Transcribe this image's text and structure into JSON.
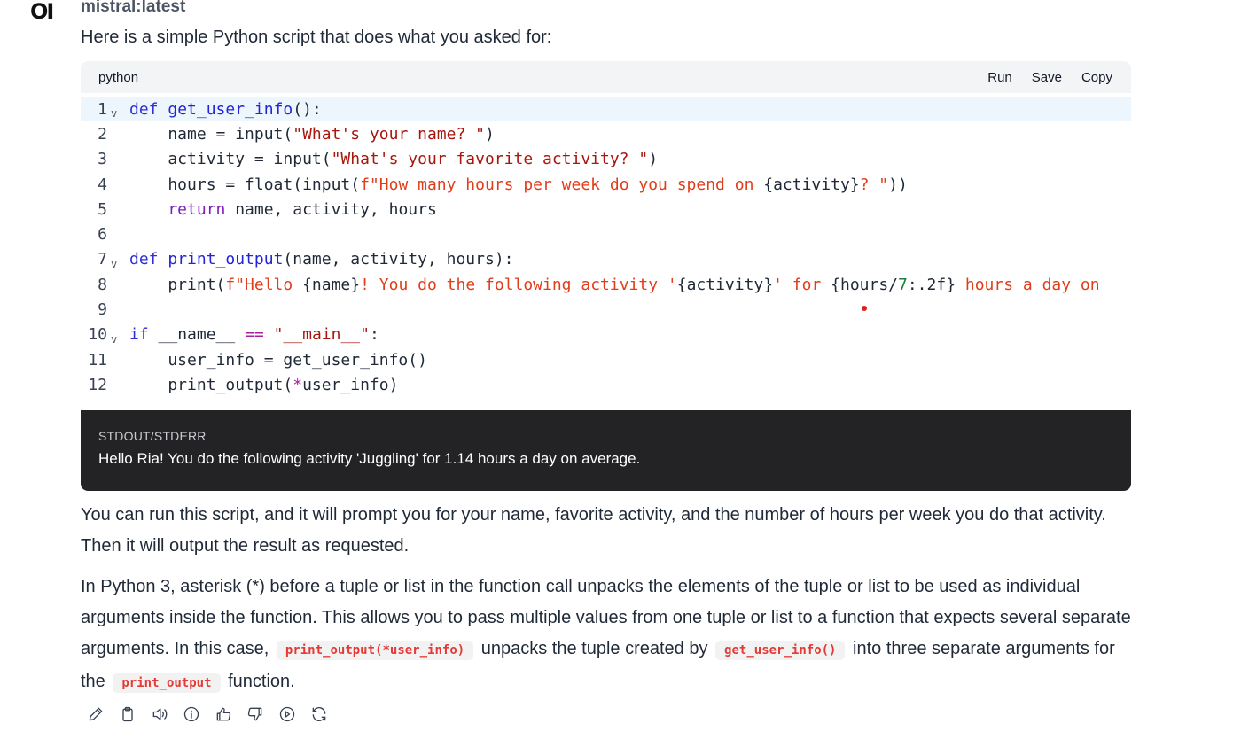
{
  "avatar": {
    "text": "OI"
  },
  "model": {
    "name": "mistral:latest"
  },
  "message": {
    "intro": "Here is a simple Python script that does what you asked for:"
  },
  "code_block": {
    "language": "python",
    "actions": {
      "run": "Run",
      "save": "Save",
      "copy": "Copy"
    },
    "lines": [
      {
        "num": "1",
        "fold": true
      },
      {
        "num": "2",
        "fold": false
      },
      {
        "num": "3",
        "fold": false
      },
      {
        "num": "4",
        "fold": false
      },
      {
        "num": "5",
        "fold": false
      },
      {
        "num": "6",
        "fold": false
      },
      {
        "num": "7",
        "fold": true
      },
      {
        "num": "8",
        "fold": false
      },
      {
        "num": "9",
        "fold": false
      },
      {
        "num": "10",
        "fold": true
      },
      {
        "num": "11",
        "fold": false
      },
      {
        "num": "12",
        "fold": false
      }
    ],
    "code": {
      "l1_def": "def",
      "l1_fn": "get_user_info",
      "l1_rest": "():",
      "l2_a": "    name = input(",
      "l2_str": "\"What's your name? \"",
      "l2_b": ")",
      "l3_a": "    activity = input(",
      "l3_str": "\"What's your favorite activity? \"",
      "l3_b": ")",
      "l4_a": "    hours = float(input(",
      "l4_f": "f\"How many hours per week do you spend on ",
      "l4_brace": "{activity}",
      "l4_f2": "? \"",
      "l4_b": "))",
      "l5_kw": "    return",
      "l5_rest": " name, activity, hours",
      "l7_def": "def",
      "l7_fn": "print_output",
      "l7_rest": "(name, activity, hours):",
      "l8_a": "    print(",
      "l8_f1": "f\"Hello ",
      "l8_b1": "{name}",
      "l8_f2": "! You do the following activity '",
      "l8_b2": "{activity}",
      "l8_f3": "' for ",
      "l8_b3a": "{hours/",
      "l8_b3n": "7",
      "l8_b3c": ":.2f}",
      "l8_f4": " hours a day on",
      "l10_kw": "if",
      "l10_a": " __name__ ",
      "l10_op": "==",
      "l10_sp": " ",
      "l10_str": "\"__main__\"",
      "l10_b": ":",
      "l11": "    user_info = get_user_info()",
      "l12_a": "    print_output(",
      "l12_op": "*",
      "l12_b": "user_info)"
    }
  },
  "stdout": {
    "label": "STDOUT/STDERR",
    "text": "Hello Ria! You do the following activity 'Juggling' for 1.14 hours a day on average."
  },
  "paragraphs": {
    "p1": "You can run this script, and it will prompt you for your name, favorite activity, and the number of hours per week you do that activity. Then it will output the result as requested.",
    "p2_a": "In Python 3, asterisk (*) before a tuple or list in the function call unpacks the elements of the tuple or list to be used as individual arguments inside the function. This allows you to pass multiple values from one tuple or list to a function that expects several separate arguments. In this case,",
    "p2_code1": "print_output(*user_info)",
    "p2_b": "unpacks the tuple created by",
    "p2_code2": "get_user_info()",
    "p2_c": "into three separate arguments for the",
    "p2_code3": "print_output",
    "p2_d": "function."
  },
  "message_actions": [
    {
      "icon": "edit-icon"
    },
    {
      "icon": "copy-icon"
    },
    {
      "icon": "read-aloud-icon"
    },
    {
      "icon": "info-icon"
    },
    {
      "icon": "thumbs-up-icon"
    },
    {
      "icon": "thumbs-down-icon"
    },
    {
      "icon": "continue-icon"
    },
    {
      "icon": "regenerate-icon"
    }
  ]
}
